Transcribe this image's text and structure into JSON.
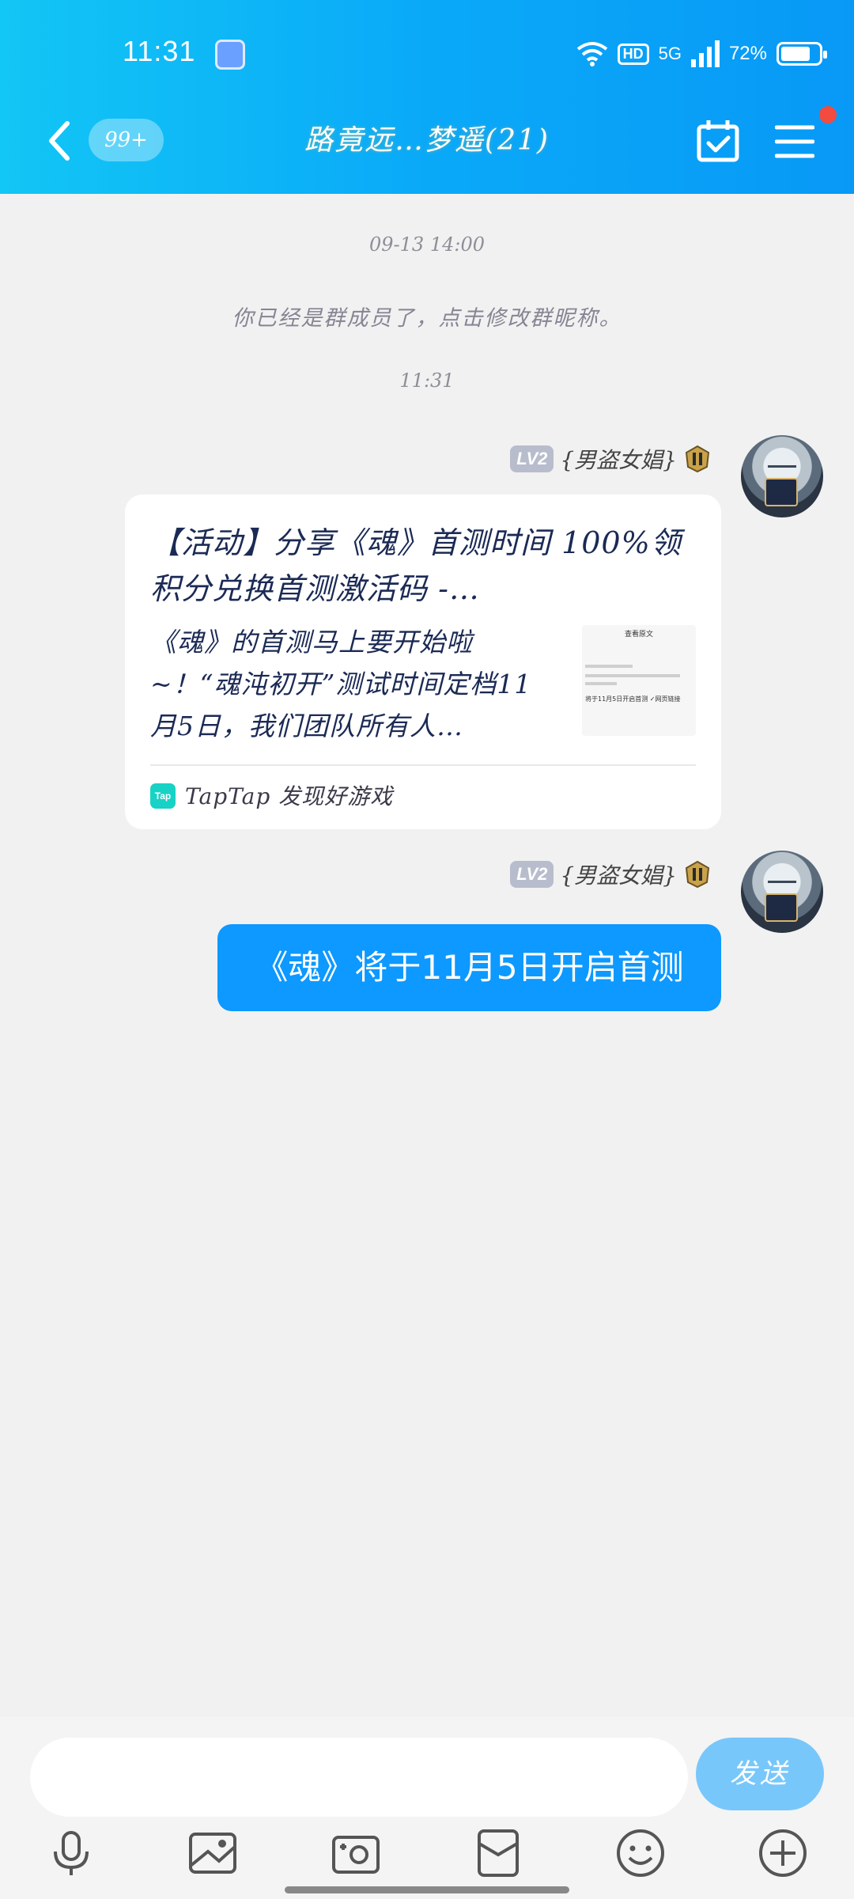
{
  "status_bar": {
    "time": "11:31",
    "network": "5G",
    "hd": "HD",
    "battery": "72%"
  },
  "header": {
    "unread_count": "99+",
    "title": "路竟远…梦遥(21)"
  },
  "chat": {
    "timestamp_1": "09-13 14:00",
    "system_notice": "你已经是群成员了，点击修改群昵称。",
    "timestamp_2": "11:31",
    "messages": [
      {
        "level": "LV2",
        "sender": "{男盗女娼}",
        "card": {
          "title": "【活动】分享《魂》首测时间 100%领积分兑换首测激活码 -…",
          "description": "《魂》的首测马上要开始啦~！“魂沌初开”测试时间定档11月5日，我们团队所有人…",
          "thumbnail_title": "查看原文",
          "thumbnail_text": "将于11月5日开启首测 ✓网页链接",
          "source": "TapTap 发现好游戏",
          "logo": "Tap"
        }
      },
      {
        "level": "LV2",
        "sender": "{男盗女娼}",
        "text": "《魂》将于11月5日开启首测"
      }
    ]
  },
  "input": {
    "placeholder": "",
    "send_label": "发送"
  },
  "colors": {
    "header_blue": "#0aa9f8",
    "bubble_blue": "#0d99ff",
    "send_button": "#78c7fb",
    "notification_red": "#f24b3f"
  },
  "icons": [
    "back-icon",
    "calendar-check-icon",
    "menu-icon",
    "microphone-icon",
    "image-icon",
    "camera-icon",
    "red-packet-icon",
    "emoji-icon",
    "plus-icon"
  ]
}
